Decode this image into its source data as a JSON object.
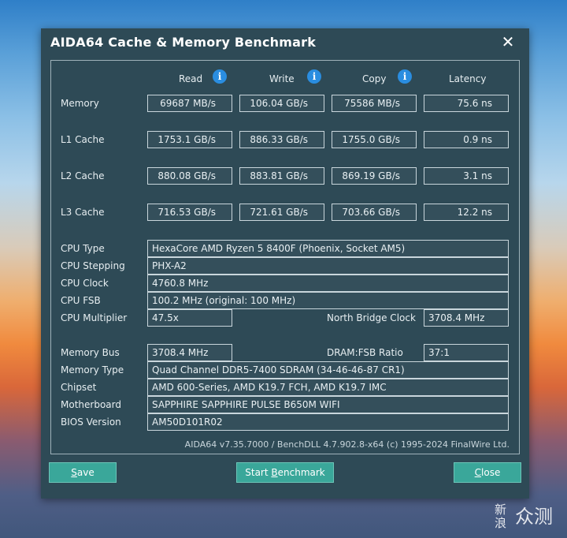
{
  "window": {
    "title": "AIDA64 Cache & Memory Benchmark",
    "close_symbol": "✕"
  },
  "columns": {
    "read": "Read",
    "write": "Write",
    "copy": "Copy",
    "latency": "Latency",
    "info_symbol": "i"
  },
  "bench": {
    "memory": {
      "label": "Memory",
      "read": "69687 MB/s",
      "write": "106.04 GB/s",
      "copy": "75586 MB/s",
      "latency": "75.6 ns"
    },
    "l1": {
      "label": "L1 Cache",
      "read": "1753.1 GB/s",
      "write": "886.33 GB/s",
      "copy": "1755.0 GB/s",
      "latency": "0.9 ns"
    },
    "l2": {
      "label": "L2 Cache",
      "read": "880.08 GB/s",
      "write": "883.81 GB/s",
      "copy": "869.19 GB/s",
      "latency": "3.1 ns"
    },
    "l3": {
      "label": "L3 Cache",
      "read": "716.53 GB/s",
      "write": "721.61 GB/s",
      "copy": "703.66 GB/s",
      "latency": "12.2 ns"
    }
  },
  "cpu": {
    "type_label": "CPU Type",
    "type_value": "HexaCore AMD Ryzen 5 8400F  (Phoenix, Socket AM5)",
    "stepping_label": "CPU Stepping",
    "stepping_value": "PHX-A2",
    "clock_label": "CPU Clock",
    "clock_value": "4760.8 MHz",
    "fsb_label": "CPU FSB",
    "fsb_value": "100.2 MHz  (original: 100 MHz)",
    "multiplier_label": "CPU Multiplier",
    "multiplier_value": "47.5x",
    "nb_clock_label": "North Bridge Clock",
    "nb_clock_value": "3708.4 MHz"
  },
  "system": {
    "membus_label": "Memory Bus",
    "membus_value": "3708.4 MHz",
    "ratio_label": "DRAM:FSB Ratio",
    "ratio_value": "37:1",
    "memtype_label": "Memory Type",
    "memtype_value": "Quad Channel DDR5-7400 SDRAM  (34-46-46-87 CR1)",
    "chipset_label": "Chipset",
    "chipset_value": "AMD 600-Series, AMD K19.7 FCH, AMD K19.7 IMC",
    "mobo_label": "Motherboard",
    "mobo_value": "SAPPHIRE SAPPHIRE PULSE B650M WIFI",
    "bios_label": "BIOS Version",
    "bios_value": "AM50D101R02"
  },
  "footer": "AIDA64 v7.35.7000 / BenchDLL 4.7.902.8-x64  (c) 1995-2024 FinalWire Ltd.",
  "buttons": {
    "save_first": "S",
    "save_rest": "ave",
    "start_pre": "Start ",
    "start_ul": "B",
    "start_post": "enchmark",
    "close_first": "C",
    "close_rest": "lose"
  },
  "watermark": {
    "line1": "新",
    "line2": "浪",
    "big": "众测"
  }
}
